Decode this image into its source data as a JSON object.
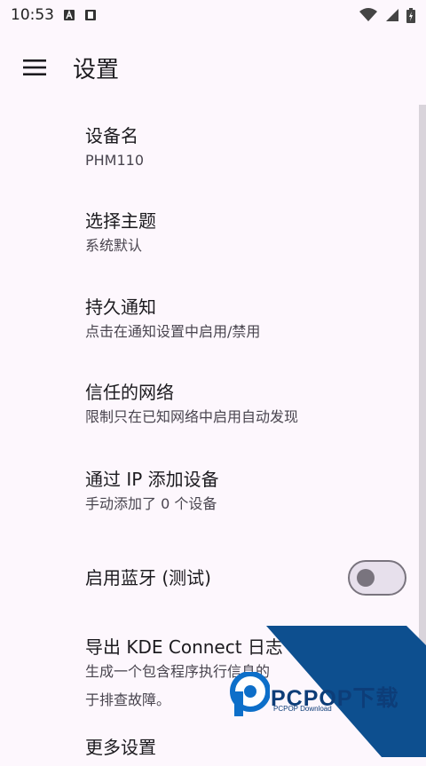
{
  "status_bar": {
    "time": "10:53"
  },
  "app_bar": {
    "title": "设置"
  },
  "settings": [
    {
      "title": "设备名",
      "subtitle": "PHM110"
    },
    {
      "title": "选择主题",
      "subtitle": "系统默认"
    },
    {
      "title": "持久通知",
      "subtitle": "点击在通知设置中启用/禁用"
    },
    {
      "title": "信任的网络",
      "subtitle": "限制只在已知网络中启用自动发现"
    },
    {
      "title": "通过 IP 添加设备",
      "subtitle": "手动添加了 0 个设备"
    },
    {
      "title": "启用蓝牙 (测试)",
      "toggle_on": false
    },
    {
      "title": "导出 KDE Connect 日志",
      "subtitle": "生成一个包含程序执行信息的",
      "subtitle2": "于排查故障。"
    },
    {
      "title": "更多设置"
    }
  ],
  "watermark": {
    "brand": "PCPOP下载",
    "sub": "PCPOP Download"
  },
  "colors": {
    "background": "#fdf7fd",
    "watermark_blue": "#0d4f8f"
  }
}
